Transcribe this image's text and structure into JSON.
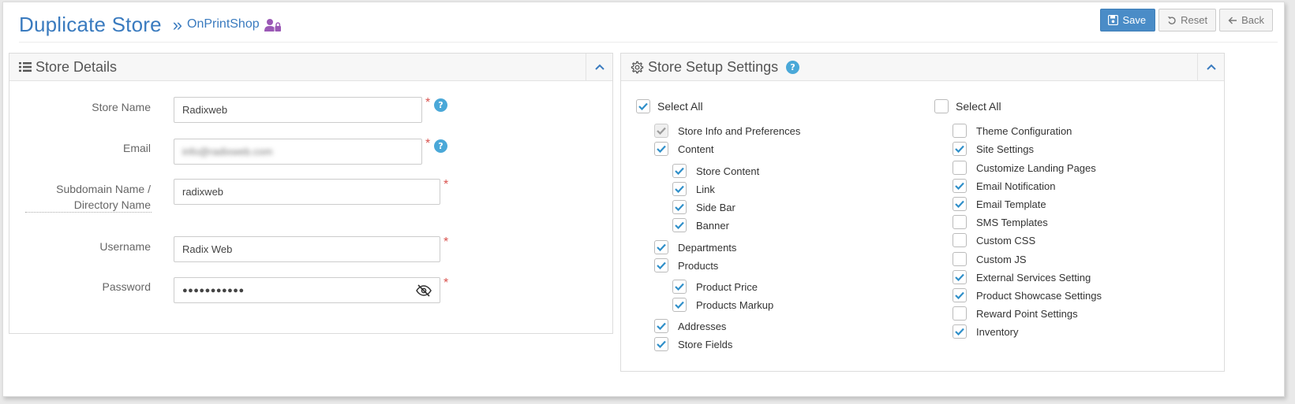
{
  "header": {
    "title": "Duplicate Store",
    "crumb_sep": "»",
    "crumb": "OnPrintShop",
    "crumb_icon": "user-lock-icon"
  },
  "toolbar": {
    "save_label": "Save",
    "reset_label": "Reset",
    "back_label": "Back"
  },
  "store_details": {
    "title": "Store Details",
    "fields": {
      "store_name": {
        "label": "Store Name",
        "value": "Radixweb"
      },
      "email": {
        "label": "Email",
        "value": "info@radixweb.com"
      },
      "subdomain": {
        "label_line1": "Subdomain Name /",
        "label_line2": "Directory Name",
        "value": "radixweb"
      },
      "username": {
        "label": "Username",
        "value": "Radix Web"
      },
      "password": {
        "label": "Password",
        "value": "●●●●●●●●●●●"
      }
    },
    "required_mark": "*",
    "help_mark": "?"
  },
  "setup": {
    "title": "Store Setup Settings",
    "help_mark": "?",
    "left": {
      "select_all": {
        "label": "Select All",
        "checked": true
      },
      "items": [
        {
          "label": "Store Info and Preferences",
          "checked": true,
          "disabled": true,
          "level": 1
        },
        {
          "label": "Content",
          "checked": true,
          "level": 1
        },
        {
          "label": "Store Content",
          "checked": true,
          "level": 2
        },
        {
          "label": "Link",
          "checked": true,
          "level": 2
        },
        {
          "label": "Side Bar",
          "checked": true,
          "level": 2
        },
        {
          "label": "Banner",
          "checked": true,
          "level": 2
        },
        {
          "label": "Departments",
          "checked": true,
          "level": 1
        },
        {
          "label": "Products",
          "checked": true,
          "level": 1
        },
        {
          "label": "Product Price",
          "checked": true,
          "level": 2
        },
        {
          "label": "Products Markup",
          "checked": true,
          "level": 2
        },
        {
          "label": "Addresses",
          "checked": true,
          "level": 1
        },
        {
          "label": "Store Fields",
          "checked": true,
          "level": 1
        }
      ]
    },
    "right": {
      "select_all": {
        "label": "Select All",
        "checked": false
      },
      "items": [
        {
          "label": "Theme Configuration",
          "checked": false
        },
        {
          "label": "Site Settings",
          "checked": true
        },
        {
          "label": "Customize Landing Pages",
          "checked": false
        },
        {
          "label": "Email Notification",
          "checked": true
        },
        {
          "label": "Email Template",
          "checked": true
        },
        {
          "label": "SMS Templates",
          "checked": false
        },
        {
          "label": "Custom CSS",
          "checked": false
        },
        {
          "label": "Custom JS",
          "checked": false
        },
        {
          "label": "External Services Setting",
          "checked": true
        },
        {
          "label": "Product Showcase Settings",
          "checked": true
        },
        {
          "label": "Reward Point Settings",
          "checked": false
        },
        {
          "label": "Inventory",
          "checked": true
        }
      ]
    }
  },
  "colors": {
    "accent": "#3a7bbf",
    "save_bg": "#4a8cc7",
    "check": "#2f8fc9",
    "required": "#d9534f",
    "help_bg": "#4aa8d8",
    "lock_icon": "#9b59b6"
  }
}
